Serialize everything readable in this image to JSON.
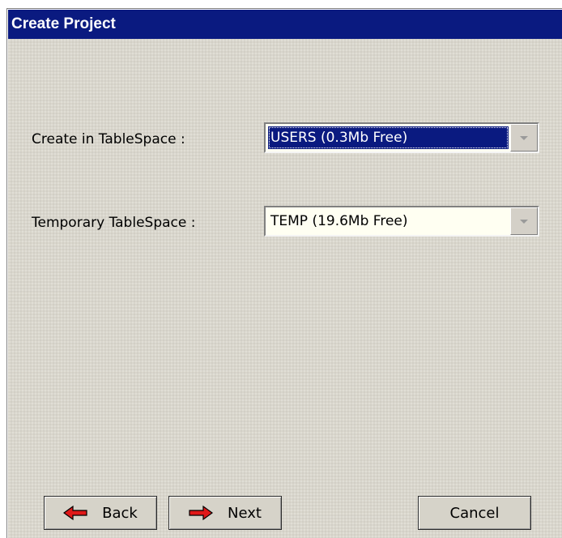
{
  "window": {
    "title": "Create Project"
  },
  "form": {
    "tablespace_label": "Create in TableSpace :",
    "tablespace_value": "USERS (0.3Mb Free)",
    "temp_tablespace_label": "Temporary TableSpace :",
    "temp_tablespace_value": "TEMP (19.6Mb Free)"
  },
  "buttons": {
    "back_label": "Back",
    "next_label": "Next",
    "cancel_label": "Cancel"
  },
  "icons": {
    "back": "red-arrow-left-icon",
    "next": "red-arrow-right-icon",
    "dropdown": "chevron-down-icon"
  },
  "colors": {
    "title_bar": "#0a1a80",
    "selection": "#0a1a80",
    "field_background": "#fffff2",
    "arrow_red": "#e01818"
  }
}
